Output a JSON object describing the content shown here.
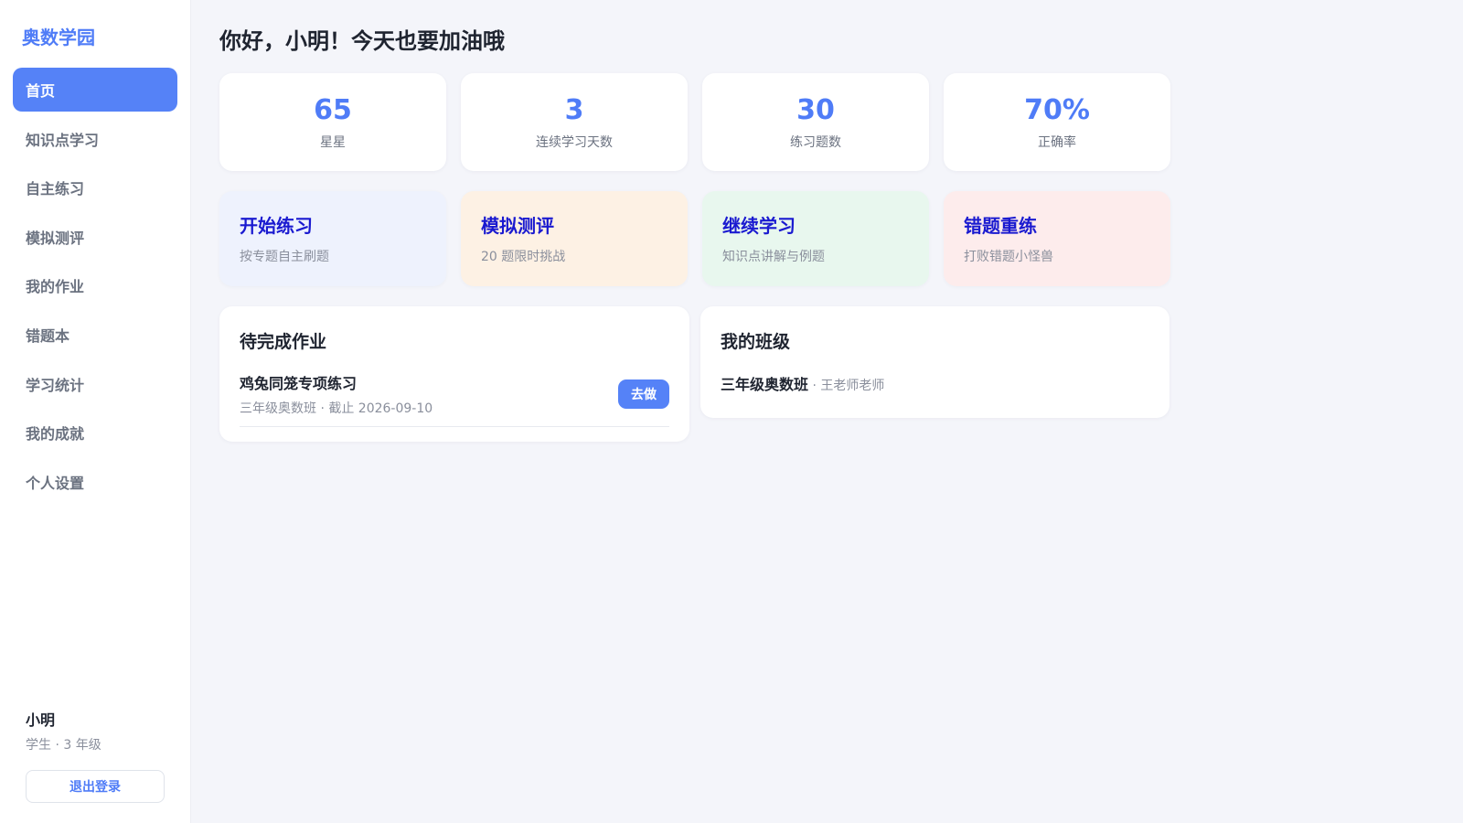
{
  "brand": "奥数学园",
  "nav": [
    {
      "label": "首页",
      "active": true
    },
    {
      "label": "知识点学习"
    },
    {
      "label": "自主练习"
    },
    {
      "label": "模拟测评"
    },
    {
      "label": "我的作业"
    },
    {
      "label": "错题本"
    },
    {
      "label": "学习统计"
    },
    {
      "label": "我的成就"
    },
    {
      "label": "个人设置"
    }
  ],
  "user": {
    "name": "小明",
    "role": "学生 · 3 年级",
    "logout": "退出登录"
  },
  "greeting": "你好，小明！今天也要加油哦",
  "stats": [
    {
      "value": "65",
      "label": "星星"
    },
    {
      "value": "3",
      "label": "连续学习天数"
    },
    {
      "value": "30",
      "label": "练习题数"
    },
    {
      "value": "70%",
      "label": "正确率"
    }
  ],
  "actions": [
    {
      "title": "开始练习",
      "sub": "按专题自主刷题",
      "bg": "#eef2fd"
    },
    {
      "title": "模拟测评",
      "sub": "20 题限时挑战",
      "bg": "#fdf1e4"
    },
    {
      "title": "继续学习",
      "sub": "知识点讲解与例题",
      "bg": "#e8f7ee"
    },
    {
      "title": "错题重练",
      "sub": "打败错题小怪兽",
      "bg": "#fdecec"
    }
  ],
  "homework": {
    "title": "待完成作业",
    "item": {
      "name": "鸡兔同笼专项练习",
      "meta": "三年级奥数班 · 截止 2026-09-10",
      "button": "去做"
    }
  },
  "classes": {
    "title": "我的班级",
    "item": {
      "name": "三年级奥数班",
      "teacher": " · 王老师老师"
    }
  }
}
